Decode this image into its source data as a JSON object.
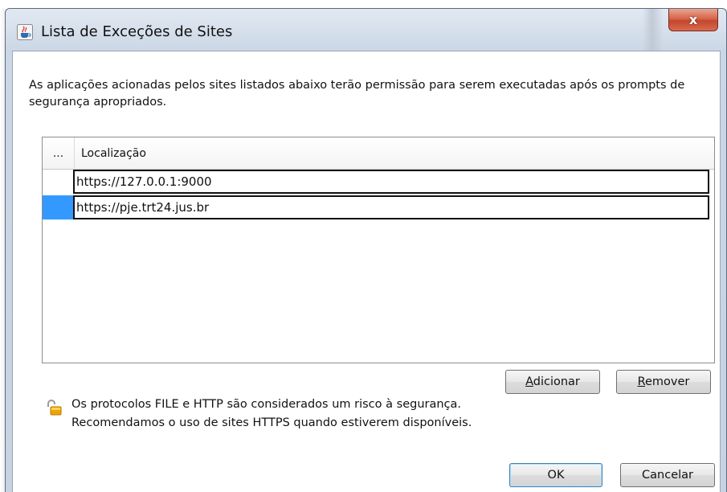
{
  "window": {
    "title": "Lista de Exceções de Sites",
    "close_glyph": "x"
  },
  "description": "As aplicações acionadas pelos sites listados abaixo terão permissão para serem executadas após os prompts de segurança apropriados.",
  "table": {
    "columns": [
      "...",
      "Localização"
    ],
    "rows": [
      {
        "url": "https://127.0.0.1:9000",
        "selected": false
      },
      {
        "url": "https://pje.trt24.jus.br",
        "selected": true
      }
    ]
  },
  "buttons": {
    "add": {
      "mnemonic": "A",
      "rest": "dicionar"
    },
    "remove": {
      "mnemonic": "R",
      "rest": "emover"
    },
    "ok": "OK",
    "cancel": "Cancelar"
  },
  "warning": {
    "line1": "Os protocolos FILE e HTTP são considerados um risco à segurança.",
    "line2": "Recomendamos o uso de sites HTTPS quando estiverem disponíveis."
  },
  "colors": {
    "selection": "#3399ff",
    "close_button": "#c4472d",
    "title_bar": "#d5dfeb"
  },
  "icons": {
    "app": "java-cup-icon",
    "warning": "unlocked-padlock-icon"
  }
}
